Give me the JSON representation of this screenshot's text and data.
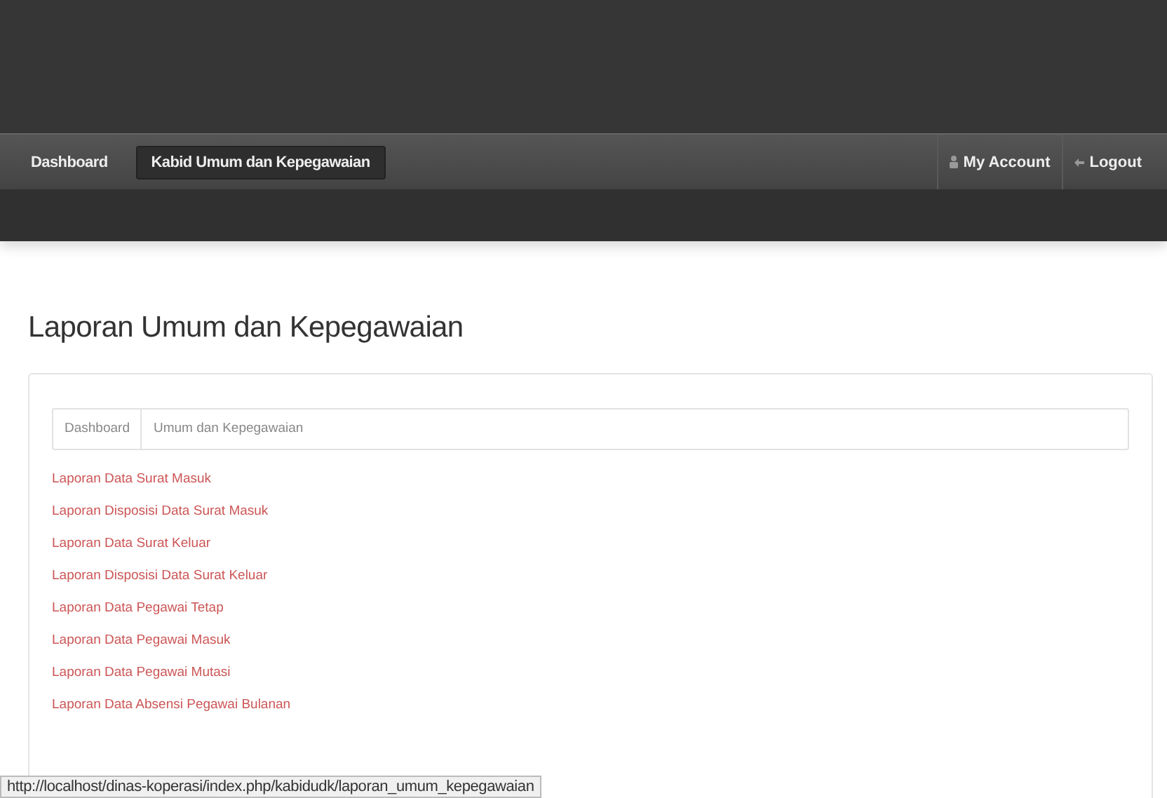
{
  "nav": {
    "items": [
      {
        "label": "Dashboard",
        "selected": false
      },
      {
        "label": "Kabid Umum dan Kepegawaian",
        "selected": true
      }
    ],
    "right": [
      {
        "kind": "account",
        "label": "My Account"
      },
      {
        "kind": "logout",
        "label": "Logout"
      }
    ]
  },
  "page_title": "Laporan Umum dan Kepegawaian",
  "breadcrumb": [
    "Dashboard",
    "Umum dan Kepegawaian"
  ],
  "links": [
    "Laporan Data Surat Masuk",
    "Laporan Disposisi Data Surat Masuk",
    "Laporan Data Surat Keluar",
    "Laporan Disposisi Data Surat Keluar",
    "Laporan Data Pegawai Tetap",
    "Laporan Data Pegawai Masuk",
    "Laporan Data Pegawai Mutasi",
    "Laporan Data Absensi Pegawai Bulanan"
  ],
  "status_bar": "http://localhost/dinas-koperasi/index.php/kabidudk/laporan_umum_kepegawaian"
}
